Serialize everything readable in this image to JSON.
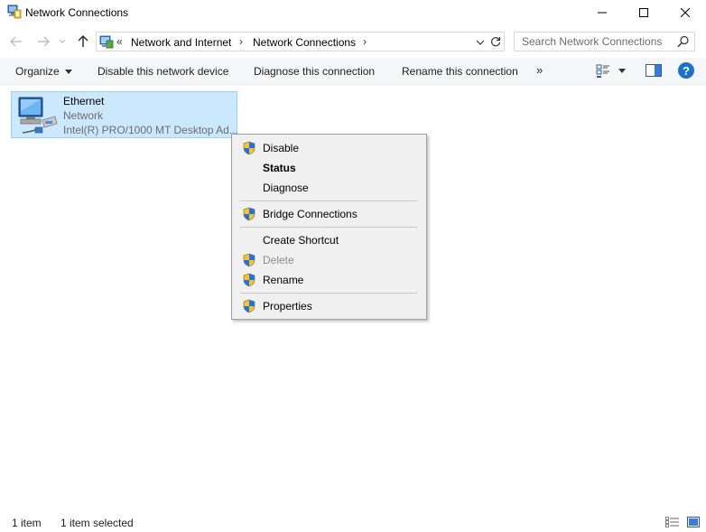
{
  "window": {
    "title": "Network Connections",
    "icon": "network-connections-icon"
  },
  "address": {
    "overflow": "«",
    "crumbs": [
      "Network and Internet",
      "Network Connections"
    ]
  },
  "search": {
    "placeholder": "Search Network Connections"
  },
  "commands": {
    "organize": "Organize",
    "disable_device": "Disable this network device",
    "diagnose": "Diagnose this connection",
    "rename": "Rename this connection",
    "more": "»"
  },
  "connection": {
    "name": "Ethernet",
    "status": "Network",
    "device": "Intel(R) PRO/1000 MT Desktop Ad..."
  },
  "context_menu": {
    "items": [
      {
        "label": "Disable",
        "icon": "uac-shield-icon",
        "bold": false,
        "disabled": false
      },
      {
        "label": "Status",
        "icon": "",
        "bold": true,
        "disabled": false
      },
      {
        "label": "Diagnose",
        "icon": "",
        "bold": false,
        "disabled": false
      },
      {
        "label": "Bridge Connections",
        "icon": "uac-shield-icon",
        "bold": false,
        "disabled": false
      },
      {
        "label": "Create Shortcut",
        "icon": "",
        "bold": false,
        "disabled": false
      },
      {
        "label": "Delete",
        "icon": "uac-shield-icon",
        "bold": false,
        "disabled": true
      },
      {
        "label": "Rename",
        "icon": "uac-shield-icon",
        "bold": false,
        "disabled": false
      },
      {
        "label": "Properties",
        "icon": "uac-shield-icon",
        "bold": false,
        "disabled": false
      }
    ]
  },
  "status": {
    "count": "1 item",
    "selected": "1 item selected"
  },
  "colors": {
    "selection_fill": "#cce8ff",
    "selection_border": "#99d1ff",
    "menu_bg": "#f0f0f0",
    "help_blue": "#1a73c9"
  }
}
